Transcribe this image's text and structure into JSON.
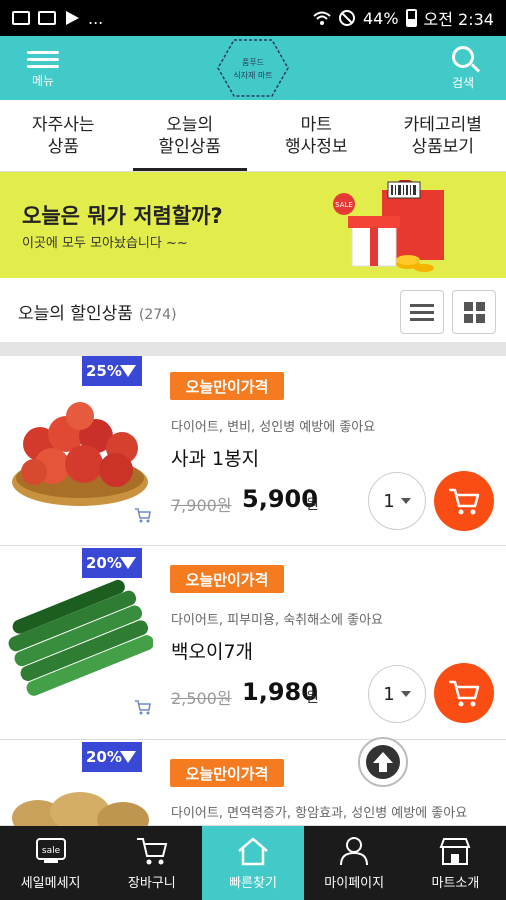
{
  "status_bar": {
    "time": "오전 2:34",
    "battery": "44%",
    "more": "..."
  },
  "header": {
    "menu_label": "메뉴",
    "search_label": "검색",
    "logo_line1": "품푸드",
    "logo_line2": "식자재 마트"
  },
  "tabs": [
    {
      "label": "자주사는\n상품",
      "active": false
    },
    {
      "label": "오늘의\n할인상품",
      "active": true
    },
    {
      "label": "마트\n행사정보",
      "active": false
    },
    {
      "label": "카테고리별\n상품보기",
      "active": false
    }
  ],
  "banner": {
    "title": "오늘은 뭐가 저렴할까?",
    "subtitle": "이곳에 모두 모아놨습니다 ~~",
    "sale_tag": "SALE"
  },
  "list_header": {
    "title": "오늘의 할인상품",
    "count": "(274)"
  },
  "products": [
    {
      "discount": "25%",
      "badge": "오늘만이가격",
      "tagline": "다이어트, 변비, 성인병 예방에 좋아요",
      "name": "사과 1봉지",
      "old_price": "7,900원",
      "price": "5,900",
      "currency": "원",
      "qty": "1"
    },
    {
      "discount": "20%",
      "badge": "오늘만이가격",
      "tagline": "다이어트, 피부미용, 숙취해소에 좋아요",
      "name": "백오이7개",
      "old_price": "2,500원",
      "price": "1,980",
      "currency": "원",
      "qty": "1"
    },
    {
      "discount": "20%",
      "badge": "오늘만이가격",
      "tagline": "다이어트, 면역력증가, 항암효과, 성인병 예방에 좋아요"
    }
  ],
  "bottom_nav": [
    {
      "label": "세일메세지",
      "icon": "sale-icon",
      "icon_text": "sale",
      "active": false
    },
    {
      "label": "장바구니",
      "icon": "cart-icon",
      "active": false
    },
    {
      "label": "빠른찾기",
      "icon": "home-icon",
      "active": true
    },
    {
      "label": "마이페이지",
      "icon": "person-icon",
      "active": false
    },
    {
      "label": "마트소개",
      "icon": "store-icon",
      "active": false
    }
  ],
  "colors": {
    "header": "#42cac8",
    "banner": "#e2ed4c",
    "discount_badge": "#3949d6",
    "today_badge": "#f57b20",
    "cart_button": "#fa4d13",
    "bottom_nav": "#1b1b1b"
  }
}
